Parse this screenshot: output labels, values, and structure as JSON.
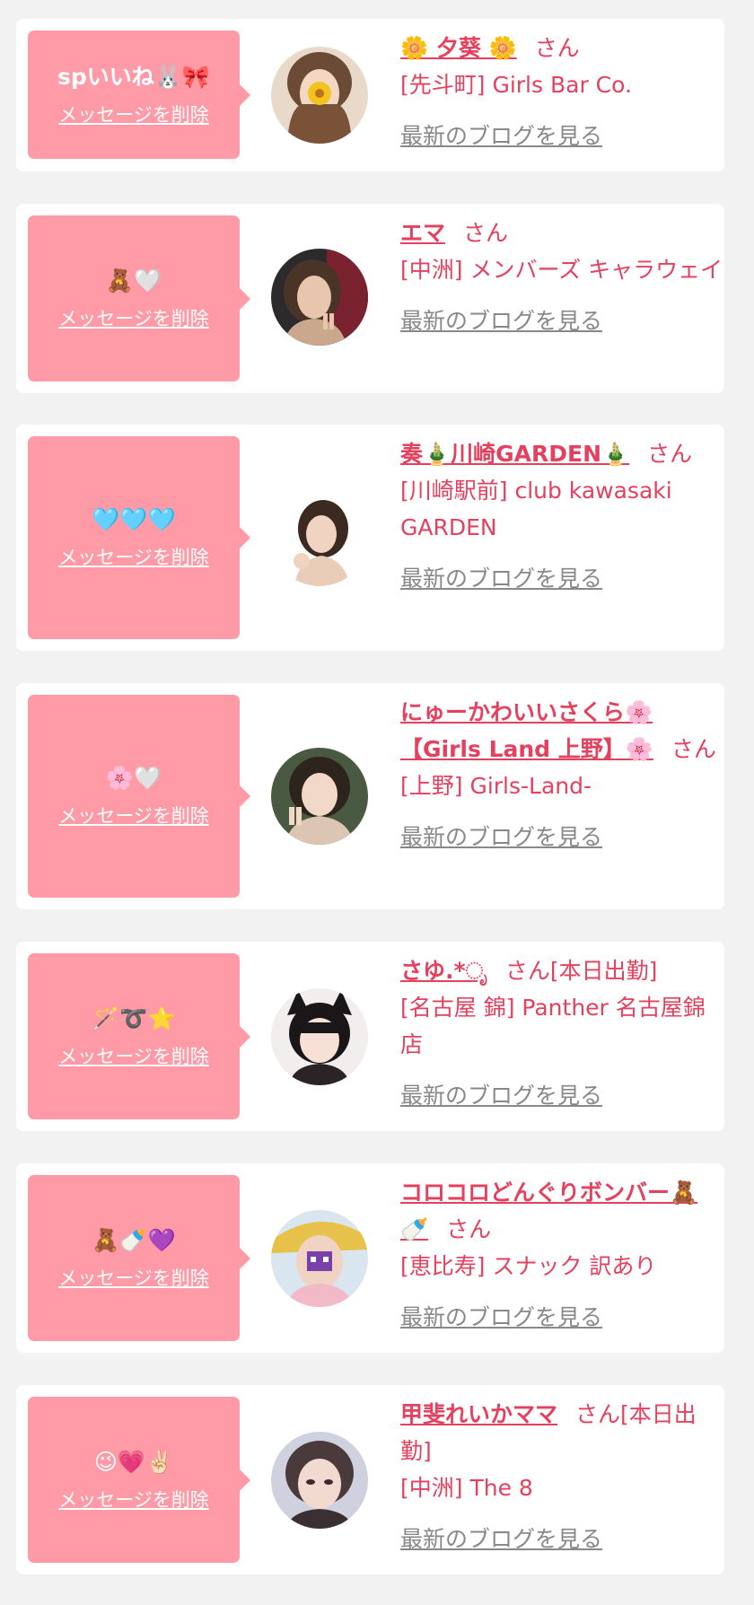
{
  "common": {
    "delete_label": "メッセージを削除",
    "blog_label": "最新のブログを見る",
    "honorific": "さん",
    "accent_color": "#e5405e",
    "bubble_color": "#ff9aa6"
  },
  "items": [
    {
      "message": "spいいね🐰🎀",
      "name": "🌼 夕葵 🌼",
      "suffix": "",
      "shop": "[先斗町] Girls Bar Co."
    },
    {
      "message": "🧸🤍",
      "name": "エマ",
      "suffix": "",
      "shop": "[中洲] メンバーズ キャラウェイ"
    },
    {
      "message": "🩵🩵🩵",
      "name": "奏🎍川崎GARDEN🎍",
      "suffix": "",
      "shop": "[川崎駅前] club kawasaki GARDEN"
    },
    {
      "message": "🌸🤍",
      "name": "にゅーかわいいさくら🌸【Girls Land 上野】🌸",
      "suffix": "",
      "shop": "[上野] Girls-Land-"
    },
    {
      "message": "🪄➰⭐",
      "name": "さゆ.*ೃ",
      "suffix": "[本日出勤]",
      "shop": "[名古屋 錦] Panther 名古屋錦店"
    },
    {
      "message": "🧸🍼💜",
      "name": "コロコロどんぐりボンバー🧸🍼",
      "suffix": "",
      "shop": "[恵比寿] スナック 訳あり"
    },
    {
      "message": "😉💗✌🏻",
      "name": "甲斐れいかママ",
      "suffix": "[本日出勤]",
      "shop": "[中洲] The 8"
    }
  ]
}
